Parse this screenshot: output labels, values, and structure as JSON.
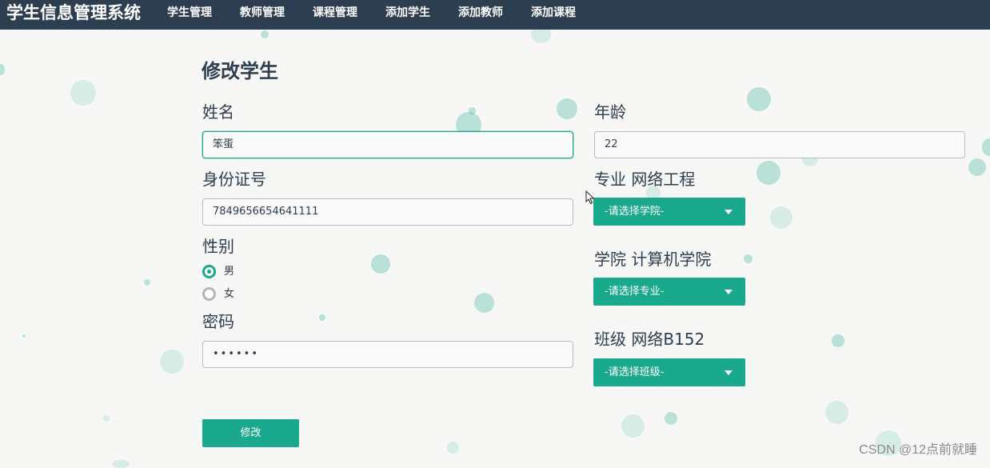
{
  "navbar": {
    "brand": "学生信息管理系统",
    "items": [
      {
        "label": "学生管理"
      },
      {
        "label": "教师管理"
      },
      {
        "label": "课程管理"
      },
      {
        "label": "添加学生"
      },
      {
        "label": "添加教师"
      },
      {
        "label": "添加课程"
      }
    ]
  },
  "form": {
    "title": "修改学生",
    "name": {
      "label": "姓名",
      "value": "笨蛋"
    },
    "id_card": {
      "label": "身份证号",
      "value": "7849656654641111"
    },
    "gender": {
      "label": "性别",
      "options": [
        {
          "label": "男",
          "checked": true
        },
        {
          "label": "女",
          "checked": false
        }
      ]
    },
    "password": {
      "label": "密码",
      "value": "••••••"
    },
    "age": {
      "label": "年龄",
      "value": "22"
    },
    "major": {
      "label": "专业 网络工程",
      "select_text": "-请选择学院-"
    },
    "college": {
      "label": "学院 计算机学院",
      "select_text": "-请选择专业-"
    },
    "class": {
      "label": "班级 网络B152",
      "select_text": "-请选择班级-"
    },
    "submit_label": "修改"
  },
  "watermark": "CSDN @12点前就睡",
  "colors": {
    "navbar": "#2c3e50",
    "accent": "#1aa98c",
    "background": "#f7f7f5"
  }
}
